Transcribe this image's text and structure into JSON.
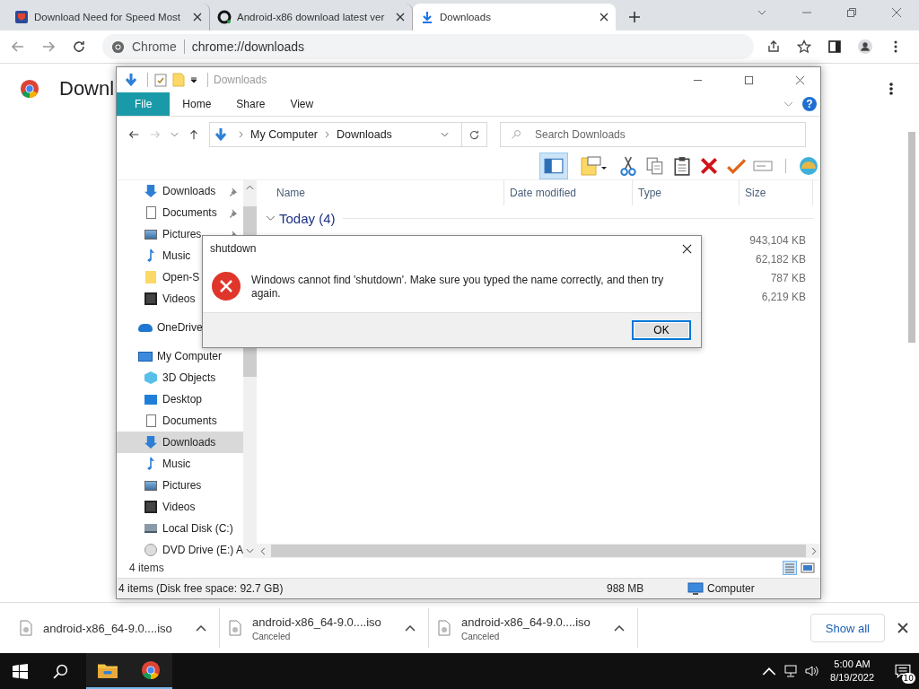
{
  "browser": {
    "tabs": [
      {
        "title": "Download Need for Speed Most",
        "selected": false
      },
      {
        "title": "Android-x86 download latest ver",
        "selected": false
      },
      {
        "title": "Downloads",
        "selected": true
      }
    ],
    "address": {
      "site": "Chrome",
      "url": "chrome://downloads"
    },
    "page": {
      "heading": "Downl"
    }
  },
  "explorer": {
    "title": "Downloads",
    "ribbon_tabs": [
      {
        "label": "File",
        "selected": true
      },
      {
        "label": "Home",
        "selected": false
      },
      {
        "label": "Share",
        "selected": false
      },
      {
        "label": "View",
        "selected": false
      }
    ],
    "help": "?",
    "breadcrumb": [
      "My Computer",
      "Downloads"
    ],
    "search": {
      "placeholder": "Search Downloads"
    },
    "quick_access": [
      {
        "label": "Downloads",
        "kind": "download",
        "pinned": true,
        "selected": false
      },
      {
        "label": "Documents",
        "kind": "document",
        "pinned": true,
        "selected": false
      },
      {
        "label": "Pictures",
        "kind": "picture",
        "pinned": true,
        "selected": false
      },
      {
        "label": "Music",
        "kind": "music",
        "selected": false
      },
      {
        "label": "Open-S",
        "kind": "folder",
        "selected": false
      },
      {
        "label": "Videos",
        "kind": "video",
        "selected": false
      }
    ],
    "locations": [
      {
        "label": "OneDrive",
        "kind": "cloud",
        "selected": false
      },
      {
        "label": "My Computer",
        "kind": "computer",
        "selected": false,
        "children": [
          {
            "label": "3D Objects",
            "kind": "cube",
            "selected": false
          },
          {
            "label": "Desktop",
            "kind": "desktop",
            "selected": false
          },
          {
            "label": "Documents",
            "kind": "document",
            "selected": false
          },
          {
            "label": "Downloads",
            "kind": "download",
            "selected": true
          },
          {
            "label": "Music",
            "kind": "music",
            "selected": false
          },
          {
            "label": "Pictures",
            "kind": "picture",
            "selected": false
          },
          {
            "label": "Videos",
            "kind": "video",
            "selected": false
          },
          {
            "label": "Local Disk (C:)",
            "kind": "disk",
            "selected": false
          },
          {
            "label": "DVD Drive (E:) A",
            "kind": "dvd",
            "selected": false
          }
        ]
      }
    ],
    "columns": [
      "Name",
      "Date modified",
      "Type",
      "Size"
    ],
    "group": "Today (4)",
    "rows": [
      {
        "size": "943,104 KB"
      },
      {
        "size": "62,182 KB"
      },
      {
        "size": "787 KB"
      },
      {
        "size": "6,219 KB"
      }
    ],
    "item_count": "4 items",
    "status_bar": {
      "summary": "4 items (Disk free space: 92.7 GB)",
      "size": "988 MB",
      "location": "Computer"
    }
  },
  "dialog": {
    "title": "shutdown",
    "message": "Windows cannot find 'shutdown'. Make sure you typed the name correctly, and then try again.",
    "button": "OK"
  },
  "download_shelf": {
    "items": [
      {
        "name": "android-x86_64-9.0....iso"
      },
      {
        "name": "android-x86_64-9.0....iso",
        "status": "Canceled"
      },
      {
        "name": "android-x86_64-9.0....iso",
        "status": "Canceled"
      }
    ],
    "show_all": "Show all"
  },
  "taskbar": {
    "time": "5:00 AM",
    "date": "8/19/2022",
    "notifications": "10"
  }
}
